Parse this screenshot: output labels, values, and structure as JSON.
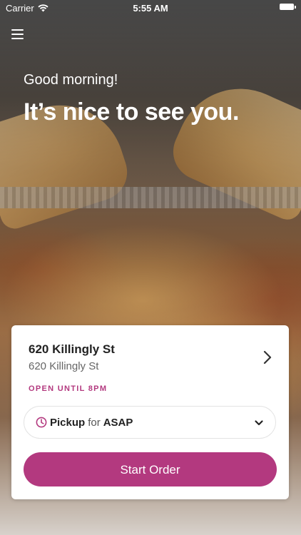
{
  "status_bar": {
    "carrier": "Carrier",
    "time": "5:55 AM"
  },
  "header": {
    "menu_icon": "hamburger-menu-icon"
  },
  "greeting": {
    "salutation": "Good morning!",
    "headline": "It’s nice to see you."
  },
  "store_card": {
    "store_name": "620 Killingly St",
    "store_address": "620 Killingly St",
    "open_status": "OPEN UNTIL 8PM",
    "pickup": {
      "mode": "Pickup",
      "connector": "for",
      "time": "ASAP"
    },
    "start_order_label": "Start Order"
  },
  "colors": {
    "accent": "#b3397f",
    "card_background": "#ffffff",
    "text_primary": "#222222",
    "text_secondary": "#666666"
  }
}
